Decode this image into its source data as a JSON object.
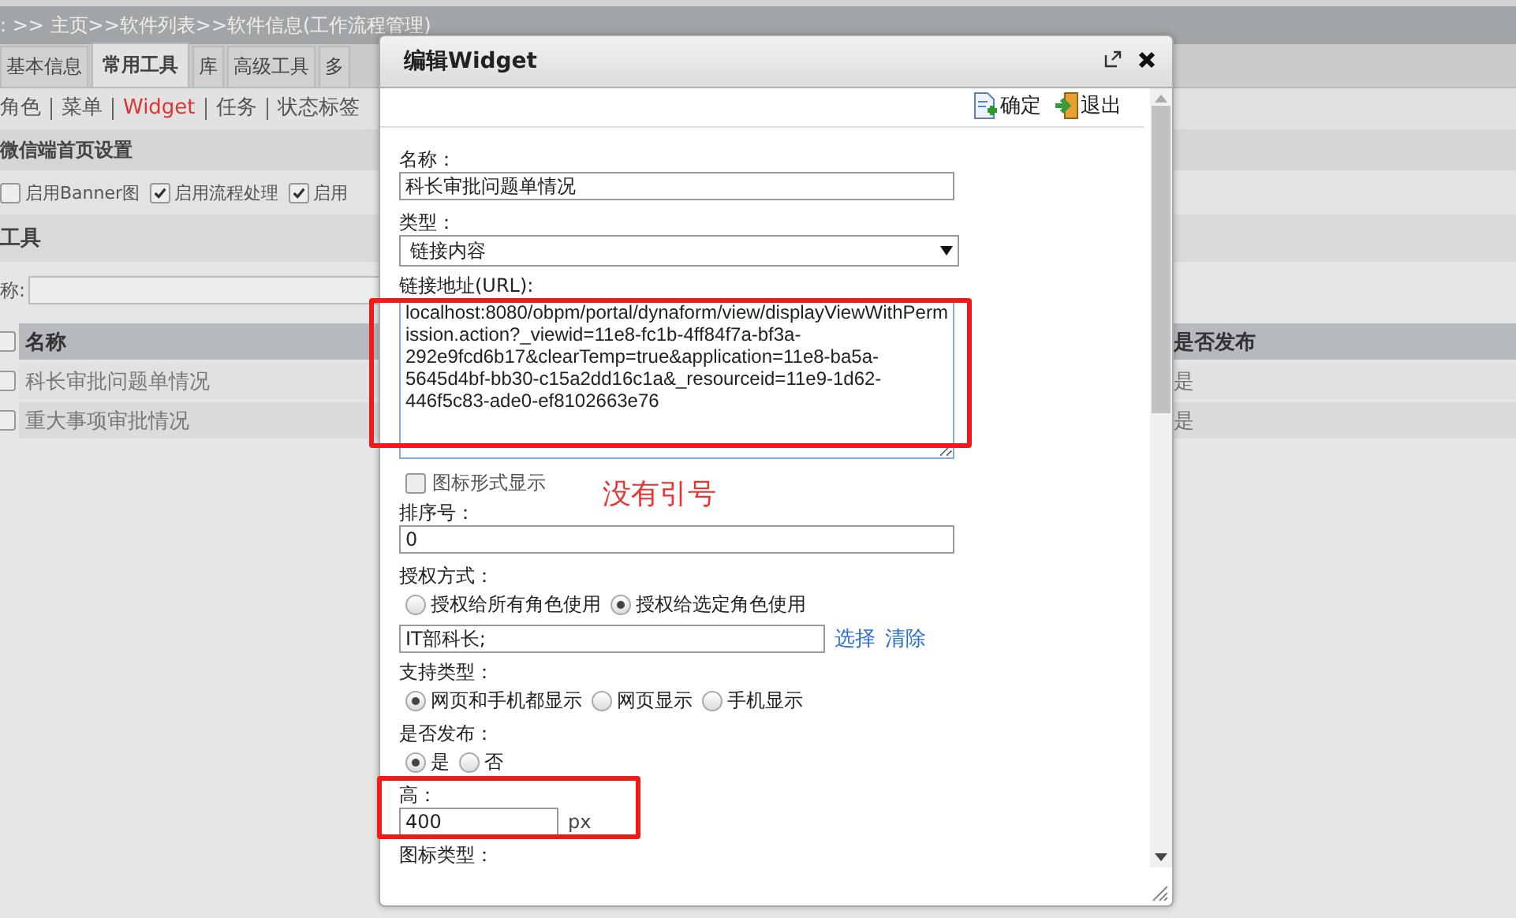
{
  "breadcrumb": ": >> 主页>>软件列表>>软件信息(工作流程管理)",
  "tabs": [
    {
      "label": "基本信息",
      "selected": false
    },
    {
      "label": "常用工具",
      "selected": true
    },
    {
      "label": "库",
      "selected": false
    },
    {
      "label": "高级工具",
      "selected": false
    },
    {
      "label": "多",
      "selected": false
    }
  ],
  "subtabs": [
    {
      "label": "角色",
      "selected": false
    },
    {
      "label": "菜单",
      "selected": false
    },
    {
      "label": "Widget",
      "selected": true
    },
    {
      "label": "任务",
      "selected": false
    },
    {
      "label": "状态标签",
      "selected": false
    }
  ],
  "section_title": "微信端首页设置",
  "options": [
    {
      "label": "启用Banner图",
      "checked": false
    },
    {
      "label": "启用流程处理",
      "checked": true
    },
    {
      "label": "启用",
      "checked": true
    }
  ],
  "tools_title": "工具",
  "search_label": "称:",
  "table": {
    "columns": [
      "名称",
      "是否发布"
    ],
    "all_checked": false,
    "rows": [
      {
        "name": "科长审批问题单情况",
        "published": "是",
        "checked": false
      },
      {
        "name": "重大事项审批情况",
        "published": "是",
        "checked": false
      }
    ]
  },
  "dialog": {
    "title": "编辑Widget",
    "actions": [
      {
        "kind": "confirm",
        "label": "确定"
      },
      {
        "kind": "exit",
        "label": "退出"
      }
    ],
    "fields": [
      {
        "kind": "text",
        "label": "名称：",
        "value": "科长审批问题单情况"
      },
      {
        "kind": "select",
        "label": "类型：",
        "value": "链接内容"
      },
      {
        "kind": "textarea",
        "label": "链接地址(URL):",
        "value": "localhost:8080/obpm/portal/dynaform/view/displayViewWithPermission.action?_viewid=11e8-fc1b-4ff84f7a-bf3a-292e9fcd6b17&clearTemp=true&application=11e8-ba5a-5645d4bf-bb30-c15a2dd16c1a&_resourceid=11e9-1d62-446f5c83-ade0-ef8102663e76",
        "annotated": true
      },
      {
        "kind": "checkbox",
        "label": "图标形式显示",
        "checked": false,
        "note": "没有引号"
      },
      {
        "kind": "text",
        "label": "排序号：",
        "value": "0"
      },
      {
        "kind": "radio",
        "label": "授权方式：",
        "options": [
          {
            "label": "授权给所有角色使用",
            "selected": false
          },
          {
            "label": "授权给选定角色使用",
            "selected": true
          }
        ]
      },
      {
        "kind": "links",
        "value": "IT部科长;",
        "links": [
          "选择",
          "清除"
        ]
      },
      {
        "kind": "radio",
        "label": "支持类型：",
        "options": [
          {
            "label": "网页和手机都显示",
            "selected": true
          },
          {
            "label": "网页显示",
            "selected": false
          },
          {
            "label": "手机显示",
            "selected": false
          }
        ]
      },
      {
        "kind": "radio",
        "label": "是否发布：",
        "options": [
          {
            "label": "是",
            "selected": true
          },
          {
            "label": "否",
            "selected": false
          }
        ]
      },
      {
        "kind": "unit",
        "label": "高：",
        "value": "400",
        "unit": "px",
        "annotated": true
      },
      {
        "kind": "heading",
        "label": "图标类型："
      }
    ]
  }
}
